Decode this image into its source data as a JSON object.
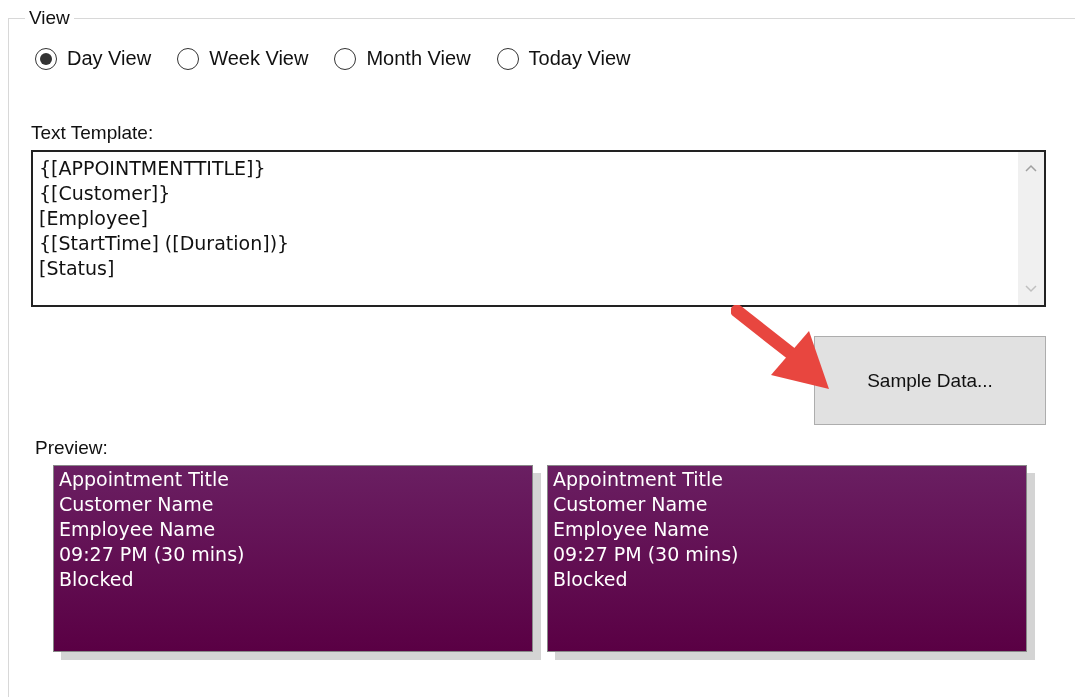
{
  "group": {
    "title": "View"
  },
  "view_options": [
    {
      "label": "Day View",
      "selected": true
    },
    {
      "label": "Week View",
      "selected": false
    },
    {
      "label": "Month View",
      "selected": false
    },
    {
      "label": "Today View",
      "selected": false
    }
  ],
  "text_template": {
    "label": "Text Template:",
    "value": [
      "{[APPOINTMENTTITLE]}",
      "{[Customer]}",
      "[Employee]",
      "{[StartTime] ([Duration])}",
      "[Status]"
    ]
  },
  "sample_button": "Sample Data...",
  "preview": {
    "label": "Preview:",
    "cards": [
      {
        "lines": [
          "Appointment Title",
          "Customer Name",
          "Employee Name",
          "09:27 PM (30 mins)",
          "Blocked"
        ]
      },
      {
        "lines": [
          "Appointment Title",
          "Customer Name",
          "Employee Name",
          "09:27 PM (30 mins)",
          "Blocked"
        ]
      }
    ]
  }
}
